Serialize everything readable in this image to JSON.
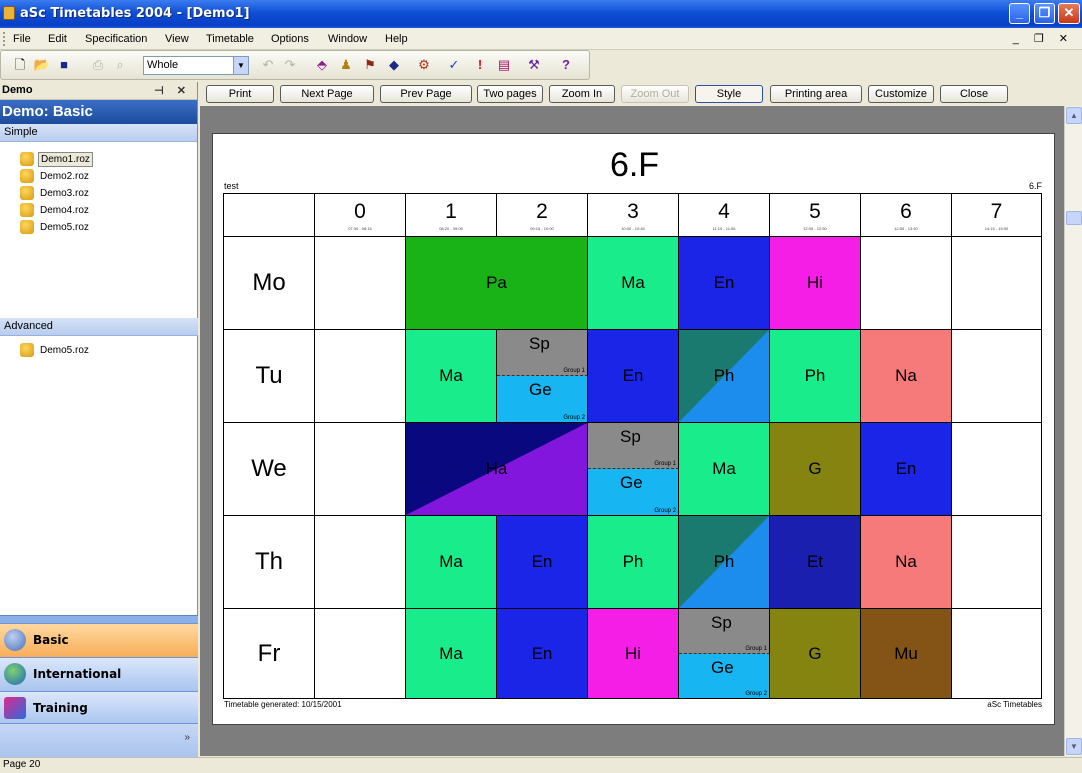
{
  "window": {
    "title": "aSc Timetables 2004  - [Demo1]"
  },
  "menu": [
    "File",
    "Edit",
    "Specification",
    "View",
    "Timetable",
    "Options",
    "Window",
    "Help"
  ],
  "toolbar": {
    "view_select": "Whole"
  },
  "sidebar": {
    "panel_label": "Demo",
    "title": "Demo: Basic",
    "simple_label": "Simple",
    "simple_files": [
      "Demo1.roz",
      "Demo2.roz",
      "Demo3.roz",
      "Demo4.roz",
      "Demo5.roz"
    ],
    "advanced_label": "Advanced",
    "advanced_files": [
      "Demo5.roz"
    ],
    "nav": [
      "Basic",
      "International",
      "Training"
    ]
  },
  "preview_toolbar": [
    "Print",
    "Next Page",
    "Prev Page",
    "Two pages",
    "Zoom In",
    "Zoom Out",
    "Style",
    "Printing area",
    "Customize",
    "Close"
  ],
  "timetable": {
    "class_name": "6.F",
    "left_note": "test",
    "right_note": "6.F",
    "footer_left": "Timetable generated: 10/15/2001",
    "footer_right": "aSc Timetables",
    "periods": [
      {
        "num": "0",
        "time": "07:30 - 08:15"
      },
      {
        "num": "1",
        "time": "08:20 - 09:05"
      },
      {
        "num": "2",
        "time": "09:15 - 10:00"
      },
      {
        "num": "3",
        "time": "10:00 - 10:45"
      },
      {
        "num": "4",
        "time": "11:10 - 11:55"
      },
      {
        "num": "5",
        "time": "12:05 - 12:50"
      },
      {
        "num": "6",
        "time": "12:55 - 13:40"
      },
      {
        "num": "7",
        "time": "14:15 - 15:00"
      }
    ],
    "days": [
      "Mo",
      "Tu",
      "We",
      "Th",
      "Fr"
    ],
    "group1_label": "Group 1",
    "group2_label": "Group 2",
    "lessons": {
      "mo_pa": "Pa",
      "mo_ma": "Ma",
      "mo_en": "En",
      "mo_hi": "Hi",
      "tu_ma": "Ma",
      "tu_sp": "Sp",
      "tu_ge": "Ge",
      "tu_en": "En",
      "tu_ph": "Ph",
      "tu_ph2": "Ph",
      "tu_na": "Na",
      "we_ha": "Ha",
      "we_sp": "Sp",
      "we_ge": "Ge",
      "we_ma": "Ma",
      "we_g": "G",
      "we_en": "En",
      "th_ma": "Ma",
      "th_en": "En",
      "th_ph": "Ph",
      "th_ph2": "Ph",
      "th_et": "Et",
      "th_na": "Na",
      "fr_ma": "Ma",
      "fr_en": "En",
      "fr_hi": "Hi",
      "fr_sp": "Sp",
      "fr_ge": "Ge",
      "fr_g": "G",
      "fr_mu": "Mu"
    }
  },
  "colors": {
    "Pa": "#19b318",
    "Ma": "#19ed8b",
    "En": "#1a25e8",
    "Hi": "#f51ee6",
    "Na": "#f77a7a",
    "Ph": "#1c8dec",
    "Ph_dark": "#1a7a70",
    "Sp": "#8a8a8a",
    "Ge": "#17b6f2",
    "G": "#858410",
    "Et": "#1a1fb0",
    "Mu": "#845416",
    "Ha_dark": "#0a087e",
    "Ha_light": "#8316dc"
  },
  "status": {
    "page": "Page 20"
  }
}
